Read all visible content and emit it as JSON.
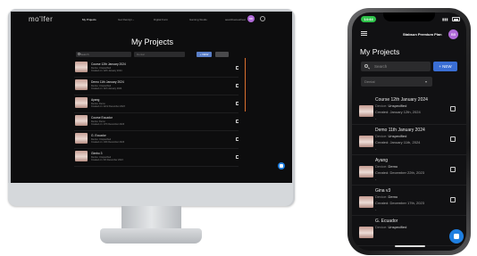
{
  "desktop": {
    "logo": "mo'lfer",
    "nav": [
      "My Projects",
      "Get Rendyx",
      "Digital Form",
      "Gaming Studio"
    ],
    "user_label": "aeanblueteetheet",
    "avatar_initials": "BB",
    "title": "My Projects",
    "search_placeholder": "Search",
    "select_value": "Dental",
    "new_label": "+ NEW",
    "rows": [
      {
        "name": "Course 12th January 2024",
        "device": "Device: Unspecified",
        "created": "Created on: 12th January 2024"
      },
      {
        "name": "Demo 11th January 2024",
        "device": "Device: Unspecified",
        "created": "Created on: 11th January 2024"
      },
      {
        "name": "Ayang",
        "device": "Device: Demo",
        "created": "Created on: 22nd December 2023"
      },
      {
        "name": "Course Ecuador",
        "device": "Device: Demo",
        "created": "Created on: 17th December 2023"
      },
      {
        "name": "G. Ecuador",
        "device": "Device: Unspecified",
        "created": "Created on: 13th December 2023"
      },
      {
        "name": "Gimbo 3",
        "device": "Device: Unspecified",
        "created": "Created on: 6th December 2023"
      }
    ]
  },
  "phone": {
    "time": "14:44",
    "signal": "▮▮▮",
    "plan": "Stabsun Premium Plan",
    "avatar_initials": "BB",
    "title": "My Projects",
    "search_placeholder": "Search",
    "new_label": "+ NEW",
    "select_value": "Dental",
    "device_prefix": "Device:",
    "rows": [
      {
        "name": "Course 12th January 2024",
        "device": "Unspecified",
        "created": "Created: January 12th, 2024",
        "dash": "-"
      },
      {
        "name": "Demo 11th January 2024",
        "device": "Unspecified",
        "created": "Created: January 11th, 2024",
        "dash": "-"
      },
      {
        "name": "Ayang",
        "device": "Demo",
        "created": "Created: December 22th, 2023",
        "dash": "-"
      },
      {
        "name": "Gina v3",
        "device": "Demo",
        "created": "Created: December 17th, 2023",
        "dash": "-"
      },
      {
        "name": "G. Ecuador",
        "device": "Unspecified",
        "created": "",
        "dash": ""
      }
    ]
  }
}
